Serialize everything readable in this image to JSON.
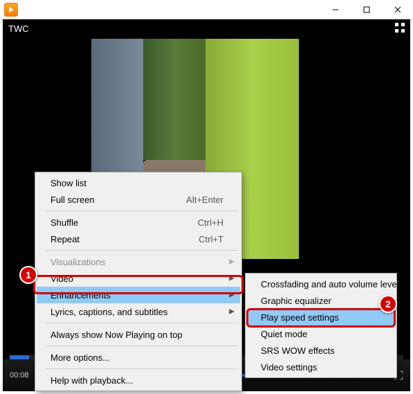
{
  "title": "TWC",
  "time_elapsed": "00:08",
  "menu": {
    "show_list": "Show list",
    "full_screen": "Full screen",
    "full_screen_sc": "Alt+Enter",
    "shuffle": "Shuffle",
    "shuffle_sc": "Ctrl+H",
    "repeat": "Repeat",
    "repeat_sc": "Ctrl+T",
    "visualizations": "Visualizations",
    "video": "Video",
    "enhancements": "Enhancements",
    "lyrics": "Lyrics, captions, and subtitles",
    "always_top": "Always show Now Playing on top",
    "more_options": "More options...",
    "help": "Help with playback..."
  },
  "submenu": {
    "crossfading": "Crossfading and auto volume leveling",
    "equalizer": "Graphic equalizer",
    "play_speed": "Play speed settings",
    "quiet": "Quiet mode",
    "srs": "SRS WOW effects",
    "video_settings": "Video settings"
  },
  "annot": {
    "one": "1",
    "two": "2"
  }
}
